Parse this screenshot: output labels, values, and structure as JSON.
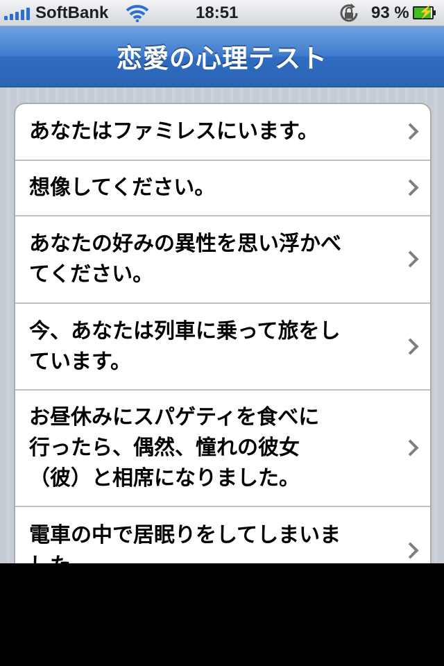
{
  "status_bar": {
    "carrier": "SoftBank",
    "time": "18:51",
    "battery_percent": "93 %",
    "battery_level": 0.93,
    "signal_icon": "signal-bars-icon",
    "wifi_icon": "wifi-icon",
    "rotation_lock_icon": "rotation-lock-icon",
    "battery_icon": "battery-charging-icon"
  },
  "nav": {
    "title": "恋愛の心理テスト"
  },
  "list": {
    "items": [
      {
        "label": "あなたはファミレスにいます。"
      },
      {
        "label": "想像してください。"
      },
      {
        "label": "あなたの好みの異性を思い浮かべ\nてください。"
      },
      {
        "label": "今、あなたは列車に乗って旅をし\nています。"
      },
      {
        "label": "お昼休みにスパゲティを食べに\n行ったら、偶然、憧れの彼女\n（彼）と相席になりました。"
      },
      {
        "label": "電車の中で居眠りをしてしまいま\nした。"
      }
    ],
    "accessory_icon": "chevron-right-icon"
  },
  "colors": {
    "nav_bar": "#3f7ccd",
    "background": "#c5ccd4",
    "battery_fill": "#3ec11f",
    "signal": "#2a6fd1"
  }
}
